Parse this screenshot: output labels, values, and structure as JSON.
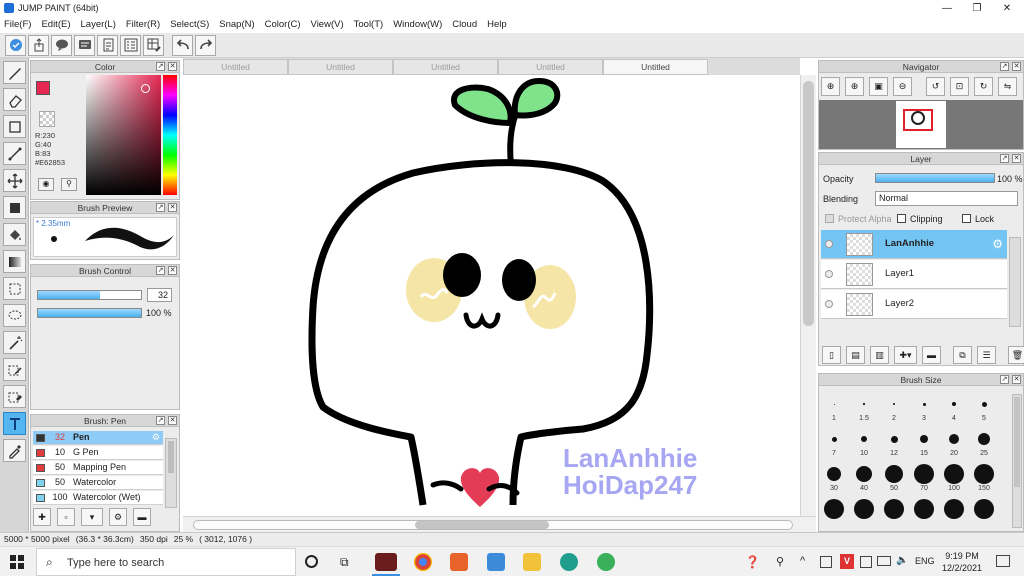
{
  "window": {
    "title": "JUMP PAINT (64bit)",
    "controls": [
      "—",
      "❐",
      "✕"
    ]
  },
  "menu": [
    "File(F)",
    "Edit(E)",
    "Layer(L)",
    "Filter(R)",
    "Select(S)",
    "Snap(N)",
    "Color(C)",
    "View(V)",
    "Tool(T)",
    "Window(W)",
    "Cloud",
    "Help"
  ],
  "tabs": [
    "Untitled",
    "Untitled",
    "Untitled",
    "Untitled",
    "Untitled"
  ],
  "color_panel": {
    "title": "Color",
    "primary": "#E62853",
    "r": "R:230",
    "g": "G:40",
    "b": "B:83",
    "hex": "#E62853"
  },
  "brush_preview": {
    "title": "Brush Preview",
    "size": "* 2.35mm"
  },
  "brush_control": {
    "title": "Brush Control",
    "size_value": "32",
    "size_fill": 0.6,
    "opacity_value": "100 %",
    "opacity_fill": 1.0
  },
  "brush_list": {
    "title": "Brush: Pen",
    "items": [
      {
        "size": "32",
        "name": "Pen",
        "color": "#333333",
        "selected": true
      },
      {
        "size": "10",
        "name": "G Pen",
        "color": "#e23b3b"
      },
      {
        "size": "50",
        "name": "Mapping Pen",
        "color": "#e23b3b"
      },
      {
        "size": "50",
        "name": "Watercolor",
        "color": "#7fd3ef"
      },
      {
        "size": "100",
        "name": "Watercolor (Wet)",
        "color": "#7fd3ef"
      }
    ]
  },
  "navigator": {
    "title": "Navigator"
  },
  "layer_panel": {
    "title": "Layer",
    "opacity_label": "Opacity",
    "opacity_value": "100 %",
    "opacity_fill": 1.0,
    "blending_label": "Blending",
    "blending_value": "Normal",
    "protect_alpha": "Protect Alpha",
    "clipping": "Clipping",
    "lock": "Lock",
    "layers": [
      {
        "name": "LanAnhhie",
        "selected": true
      },
      {
        "name": "Layer1"
      },
      {
        "name": "Layer2"
      }
    ]
  },
  "brush_size": {
    "title": "Brush Size",
    "labels": [
      "1",
      "1.5",
      "2",
      "3",
      "4",
      "5",
      "7",
      "10",
      "12",
      "15",
      "20",
      "25",
      "30",
      "40",
      "50",
      "70",
      "100",
      "150",
      "",
      "",
      "",
      "",
      "",
      ""
    ]
  },
  "canvas": {
    "watermark1": "LanAnhhie",
    "watermark2": "HoiDap247"
  },
  "status": {
    "size": "5000 * 5000 pixel",
    "cm": "(36.3 * 36.3cm)",
    "dpi": "350 dpi",
    "zoom": "25 %",
    "pos": "( 3012, 1076 )"
  },
  "taskbar": {
    "search_placeholder": "Type here to search",
    "time": "9:19 PM",
    "date": "12/2/2021",
    "lang": "ENG"
  },
  "colors": {
    "accent": "#53b6f0",
    "leaf": "#7fe38c",
    "cheek": "#f5e6a8",
    "heart": "#e43b57"
  }
}
